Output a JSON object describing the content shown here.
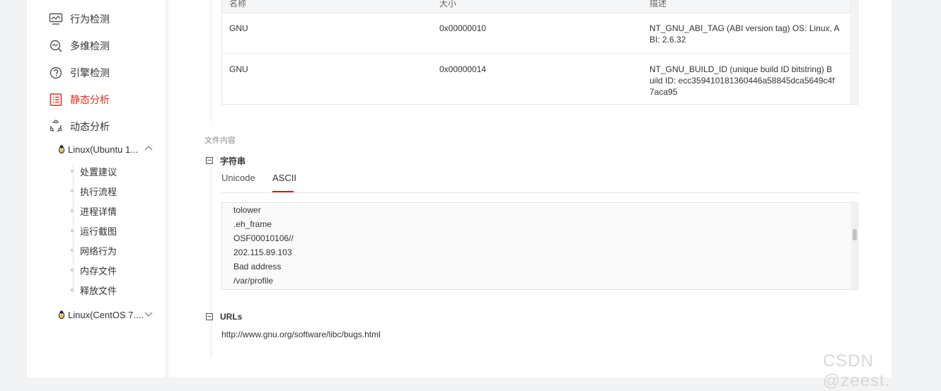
{
  "sidebar": {
    "items": [
      {
        "label": "行为检测",
        "icon": "monitor-icon",
        "active": false
      },
      {
        "label": "多维检测",
        "icon": "multi-scan-icon",
        "active": false
      },
      {
        "label": "引擎检测",
        "icon": "engine-gauge-icon",
        "active": false
      },
      {
        "label": "静态分析",
        "icon": "list-document-icon",
        "active": true
      },
      {
        "label": "动态分析",
        "icon": "cycle-icon",
        "active": false
      }
    ],
    "env1": {
      "label": "Linux(Ubuntu 1...",
      "icon": "linux-penguin-icon",
      "chevron": "chevron-up-icon"
    },
    "env1_children": [
      "处置建议",
      "执行流程",
      "进程详情",
      "运行截图",
      "网络行为",
      "内存文件",
      "释放文件"
    ],
    "env2": {
      "label": "Linux(CentOS 7....",
      "icon": "linux-penguin-icon",
      "chevron": "chevron-down-icon"
    }
  },
  "notes_table": {
    "headers": [
      "名称",
      "大小",
      "描述"
    ],
    "rows": [
      {
        "name": "GNU",
        "size": "0x00000010",
        "desc": [
          "NT_GNU_ABI_TAG (ABI version tag) OS: Linux, A",
          "BI: 2.6.32"
        ]
      },
      {
        "name": "GNU",
        "size": "0x00000014",
        "desc": [
          "NT_GNU_BUILD_ID (unique build ID bitstring) B",
          "uild ID: ecc359410181360446a58845dca5649c4f",
          "7aca95"
        ]
      }
    ]
  },
  "file_content": {
    "caption": "文件内容",
    "strings_title": "字符串",
    "tabs": [
      {
        "label": "Unicode",
        "active": false
      },
      {
        "label": "ASCII",
        "active": true
      }
    ],
    "ascii_strings": [
      "tolower",
      ".eh_frame",
      "OSF00010106//",
      "202.115.89.103",
      "Bad address",
      "/var/profile"
    ],
    "urls_title": "URLs",
    "urls": [
      "http://www.gnu.org/software/libc/bugs.html"
    ]
  },
  "watermark": "CSDN @zeest.",
  "colors": {
    "accent": "#e0301e",
    "tab_underline": "#d41c1c",
    "background": "#f2f3f5"
  }
}
